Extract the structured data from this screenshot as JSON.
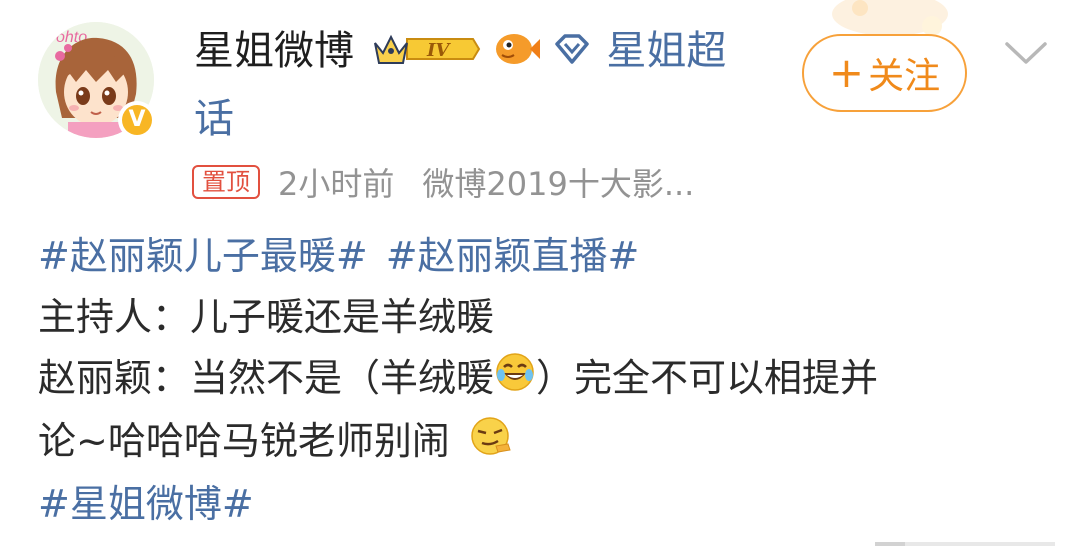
{
  "post": {
    "author": {
      "name": "星姐微博",
      "level_badge": "IV"
    },
    "supertopic_label": "星姐超",
    "supertopic_label_cont": "话",
    "follow_label": "关注",
    "pinned_label": "置顶",
    "time": "2小时前",
    "source": "微博2019十大影...",
    "hashtags_line": [
      "#赵丽颖儿子最暖#",
      "#赵丽颖直播#"
    ],
    "lines": [
      "主持人：儿子暖还是羊绒暖",
      "赵丽颖：当然不是（羊绒暖",
      "）完全不可以相提并",
      "论~哈哈哈马锐老师别闹"
    ],
    "footer_tag": "#星姐微博#"
  },
  "icons": {
    "crown": "crown-icon",
    "fish": "fish-icon",
    "diamond": "diamond-icon",
    "verified": "verified-v-icon",
    "chevron": "chevron-down-icon",
    "laugh_emoji": "laughing-tears-emoji",
    "smirk_emoji": "smirk-emoji"
  },
  "colors": {
    "link_blue": "#4a6fa3",
    "follow_orange": "#f08a1b",
    "pin_red": "#e2503f",
    "meta_gray": "#939393"
  }
}
